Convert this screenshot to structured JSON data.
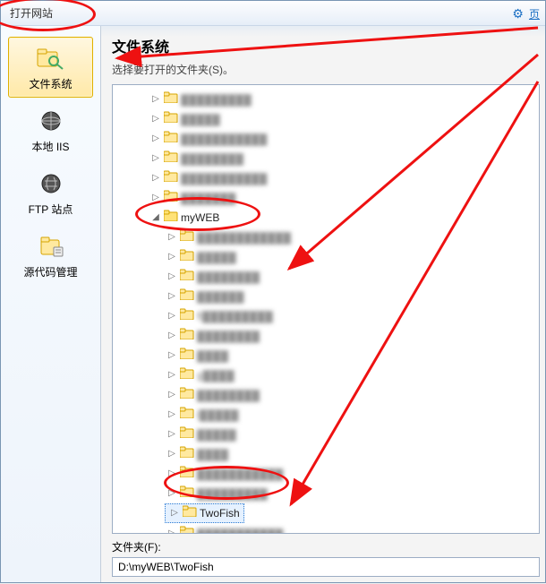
{
  "titlebar": {
    "title": "打开网站"
  },
  "toplink": {
    "text": "页"
  },
  "sidebar": {
    "items": [
      {
        "label": "文件系统",
        "active": true
      },
      {
        "label": "本地 IIS"
      },
      {
        "label": "FTP 站点"
      },
      {
        "label": "源代码管理"
      }
    ]
  },
  "main": {
    "heading": "文件系统",
    "subtitle": "选择要打开的文件夹(S)。"
  },
  "tree": {
    "blurred_top": [
      "▓▓▓▓▓▓▓▓▓",
      "▓▓▓▓▓",
      "▓▓▓▓▓▓▓▓▓▓▓",
      "▓▓▓▓▓▓▓▓",
      "▓▓▓▓▓▓▓▓▓▓▓",
      "▓▓▓▓▓▓▓"
    ],
    "expanded": {
      "label": "myWEB",
      "children_blurred": [
        "▓▓▓▓▓▓▓▓▓▓▓▓",
        "▓▓▓▓▓",
        "▓▓▓▓▓▓▓▓",
        "▓▓▓▓▓▓",
        "fi▓▓▓▓▓▓▓▓▓",
        "▓▓▓▓▓▓▓▓",
        "▓▓▓▓",
        "g▓▓▓▓",
        "▓▓▓▓▓▓▓▓",
        "i▓▓▓▓▓",
        "▓▓▓▓▓",
        "▓▓▓▓",
        "▓▓▓▓▓▓▓▓▓▓▓",
        "▓▓▓▓▓▓▓▓▓"
      ],
      "selected": {
        "label": "TwoFish"
      },
      "after_blurred": [
        "▓▓▓▓▓▓▓▓▓▓▓"
      ]
    },
    "bottom_blurred": [
      "Program Files"
    ]
  },
  "footer": {
    "label": "文件夹(F):",
    "path": "D:\\myWEB\\TwoFish"
  },
  "icons": {
    "expand_closed": "▷",
    "expand_open": "◢"
  }
}
